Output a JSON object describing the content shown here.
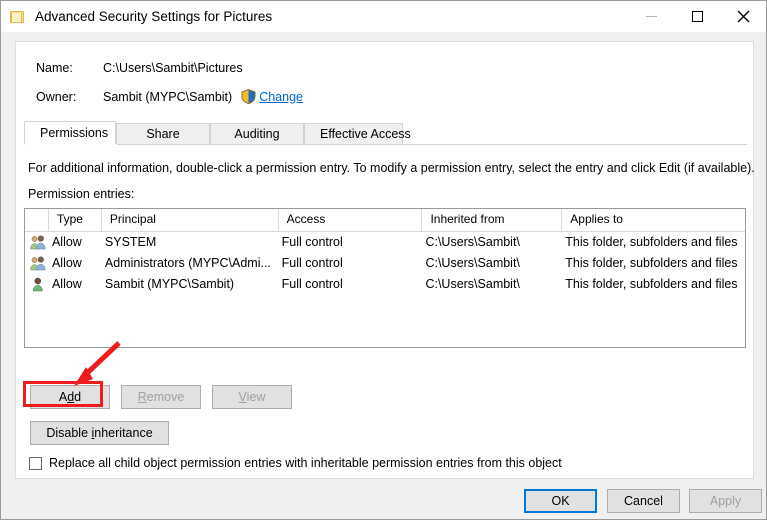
{
  "window": {
    "title": "Advanced Security Settings for Pictures",
    "icon": "folder-icon",
    "controls": {
      "minimize": "minimize-icon",
      "maximize": "maximize-icon",
      "close": "close-icon"
    }
  },
  "info": {
    "name_label": "Name:",
    "name_value": "C:\\Users\\Sambit\\Pictures",
    "owner_label": "Owner:",
    "owner_value": "Sambit (MYPC\\Sambit)",
    "change_link": "Change",
    "shield_icon": "uac-shield-icon"
  },
  "tabs": [
    {
      "label": "Permissions",
      "active": true
    },
    {
      "label": "Share",
      "active": false
    },
    {
      "label": "Auditing",
      "active": false
    },
    {
      "label": "Effective Access",
      "active": false
    }
  ],
  "main": {
    "description": "For additional information, double-click a permission entry. To modify a permission entry, select the entry and click Edit (if available).",
    "entries_label": "Permission entries:"
  },
  "table": {
    "columns": [
      "",
      "Type",
      "Principal",
      "Access",
      "Inherited from",
      "Applies to"
    ],
    "rows": [
      {
        "icon": "group-icon",
        "type": "Allow",
        "principal": "SYSTEM",
        "access": "Full control",
        "inherited_from": "C:\\Users\\Sambit\\",
        "applies_to": "This folder, subfolders and files"
      },
      {
        "icon": "group-icon",
        "type": "Allow",
        "principal": "Administrators (MYPC\\Admi...",
        "access": "Full control",
        "inherited_from": "C:\\Users\\Sambit\\",
        "applies_to": "This folder, subfolders and files"
      },
      {
        "icon": "user-icon",
        "type": "Allow",
        "principal": "Sambit (MYPC\\Sambit)",
        "access": "Full control",
        "inherited_from": "C:\\Users\\Sambit\\",
        "applies_to": "This folder, subfolders and files"
      }
    ]
  },
  "buttons": {
    "add": "Add",
    "add_accel_before": "A",
    "add_accel_char": "d",
    "add_accel_after": "d",
    "remove": "Remove",
    "remove_accel_char": "R",
    "remove_accel_after": "emove",
    "view": "View",
    "view_accel_char": "V",
    "view_accel_after": "iew",
    "disable_inheritance_before": "Disable ",
    "disable_inheritance_accel": "i",
    "disable_inheritance_after": "nheritance"
  },
  "checkbox": {
    "label": "Replace all child object permission entries with inheritable permission entries from this object",
    "checked": false
  },
  "footer": {
    "ok": "OK",
    "cancel": "Cancel",
    "apply": "Apply"
  },
  "annotation": {
    "highlight_target": "Add",
    "color": "#ee1c1c"
  },
  "colors": {
    "link": "#0066cc",
    "focus_border": "#0078d7",
    "annotation_red": "#ee1c1c",
    "button_face": "#e1e1e1",
    "disabled_text": "#a0a0a0"
  }
}
